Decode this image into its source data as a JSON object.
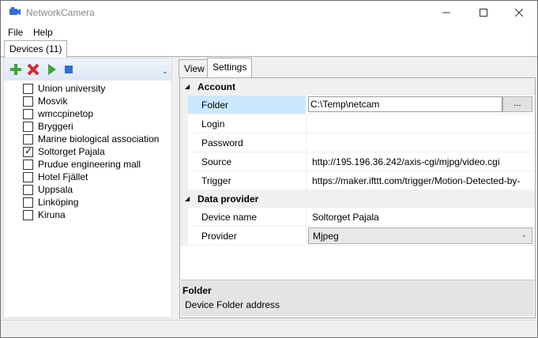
{
  "window": {
    "title": "NetworkCamera"
  },
  "menu": {
    "file": "File",
    "help": "Help"
  },
  "outer_tabs": {
    "devices": "Devices (11)"
  },
  "toolbar": {
    "icons": [
      "add-icon",
      "delete-icon",
      "play-icon",
      "stop-icon"
    ],
    "overflow_glyph": "⌄"
  },
  "devices": [
    {
      "name": "Union university",
      "checked": false
    },
    {
      "name": "Mosvik",
      "checked": false
    },
    {
      "name": "wmccpinetop",
      "checked": false
    },
    {
      "name": "Bryggeri",
      "checked": false
    },
    {
      "name": "Marine biological association",
      "checked": false
    },
    {
      "name": "Soltorget Pajala",
      "checked": true
    },
    {
      "name": "Prudue engineering mall",
      "checked": false
    },
    {
      "name": "Hotel Fjället",
      "checked": false
    },
    {
      "name": "Uppsala",
      "checked": false
    },
    {
      "name": "Linköping",
      "checked": false
    },
    {
      "name": "Kiruna",
      "checked": false
    }
  ],
  "inner_tabs": {
    "view": "View",
    "settings": "Settings"
  },
  "properties": {
    "account": {
      "label": "Account",
      "folder": {
        "name": "Folder",
        "value": "C:\\Temp\\netcam",
        "browse": "..."
      },
      "login": {
        "name": "Login",
        "value": ""
      },
      "password": {
        "name": "Password",
        "value": ""
      },
      "source": {
        "name": "Source",
        "value": "http://195.196.36.242/axis-cgi/mjpg/video.cgi"
      },
      "trigger": {
        "name": "Trigger",
        "value": "https://maker.ifttt.com/trigger/Motion-Detected-by-"
      }
    },
    "data_provider": {
      "label": "Data provider",
      "device_name": {
        "name": "Device name",
        "value": "Soltorget Pajala"
      },
      "provider": {
        "name": "Provider",
        "value": "Mjpeg"
      }
    }
  },
  "description": {
    "title": "Folder",
    "text": "Device Folder address"
  },
  "colors": {
    "selection": "#cce8ff",
    "accent_add": "#3ea53a",
    "accent_delete": "#d9262d",
    "accent_stop": "#2f6fd6"
  }
}
